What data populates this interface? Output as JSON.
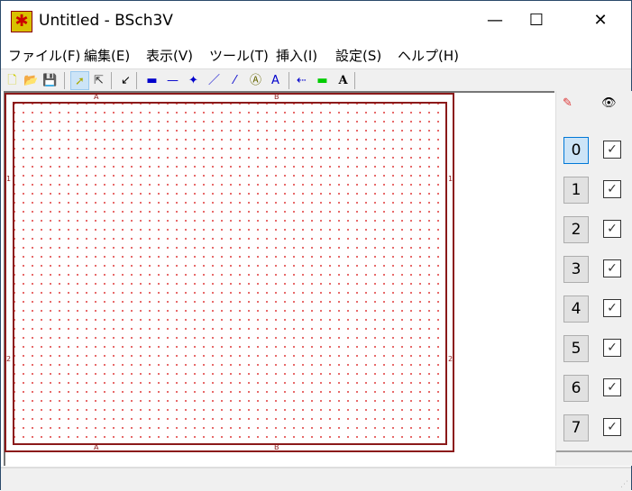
{
  "window": {
    "title": "Untitled - BSch3V",
    "minimize": "—",
    "maximize": "☐",
    "close": "✕"
  },
  "menu": [
    "ファイル(F)",
    "編集(E)",
    "表示(V)",
    "ツール(T)",
    "挿入(I)",
    "設定(S)",
    "ヘルプ(H)"
  ],
  "toolbar": [
    {
      "name": "new-icon",
      "glyph": "🗋"
    },
    {
      "name": "open-icon",
      "glyph": "📂"
    },
    {
      "name": "save-icon",
      "glyph": "💾"
    },
    {
      "name": "select-arrow-icon",
      "glyph": "➚",
      "selected": true
    },
    {
      "name": "drag-component-icon",
      "glyph": "⇱"
    },
    {
      "name": "tag-icon",
      "glyph": "↙"
    },
    {
      "name": "bus-icon",
      "glyph": "▬"
    },
    {
      "name": "wire-icon",
      "glyph": "—"
    },
    {
      "name": "junction-icon",
      "glyph": "✦"
    },
    {
      "name": "bus-entry-icon",
      "glyph": "／"
    },
    {
      "name": "wire-entry-icon",
      "glyph": "⁄"
    },
    {
      "name": "label-icon",
      "glyph": "Ⓐ"
    },
    {
      "name": "comment-icon",
      "glyph": "A"
    },
    {
      "name": "marker-line-icon",
      "glyph": "⇠"
    },
    {
      "name": "image-icon",
      "glyph": "▬"
    },
    {
      "name": "text-icon",
      "glyph": "A"
    }
  ],
  "sheet": {
    "col_labels": [
      "A",
      "B"
    ],
    "row_labels": [
      "1",
      "2"
    ]
  },
  "layers": {
    "edit_icon": "pencil-icon",
    "view_icon": "eye-icon",
    "items": [
      "0",
      "1",
      "2",
      "3",
      "4",
      "5",
      "6",
      "7"
    ],
    "active": "0",
    "check": "✓"
  }
}
